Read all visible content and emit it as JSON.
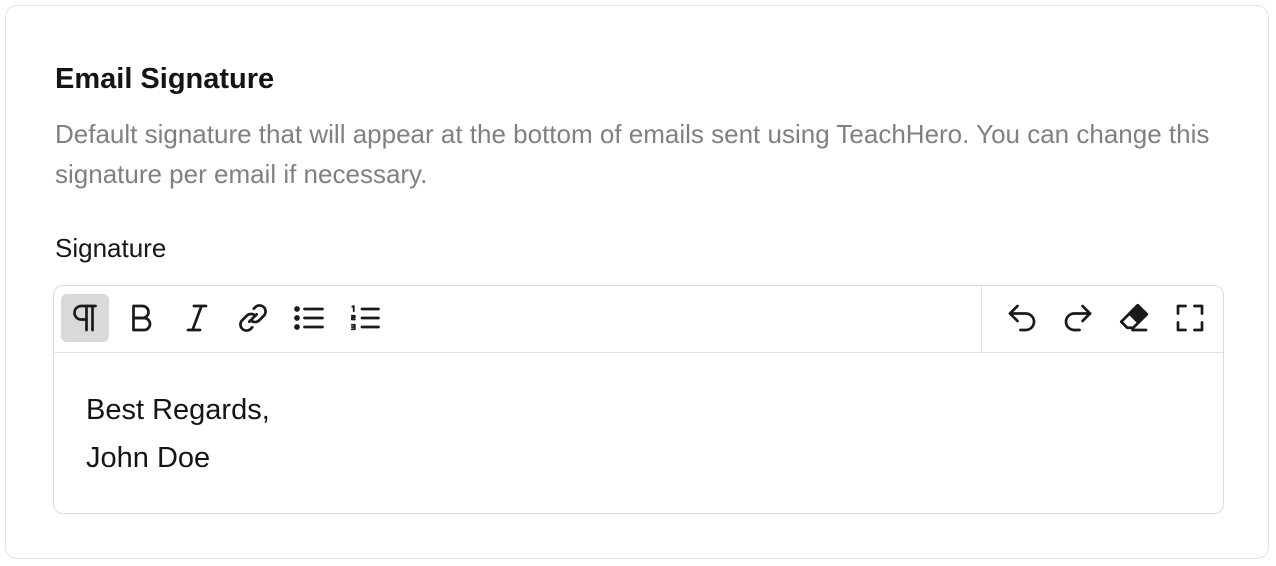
{
  "section": {
    "title": "Email Signature",
    "description": "Default signature that will appear at the bottom of emails sent using TeachHero. You can change this signature per email if necessary."
  },
  "field": {
    "label": "Signature"
  },
  "editor": {
    "toolbar_left": [
      {
        "icon": "paragraph-icon",
        "active": true
      },
      {
        "icon": "bold-icon",
        "active": false
      },
      {
        "icon": "italic-icon",
        "active": false
      },
      {
        "icon": "link-icon",
        "active": false
      },
      {
        "icon": "bullet-list-icon",
        "active": false
      },
      {
        "icon": "numbered-list-icon",
        "active": false
      }
    ],
    "toolbar_right": [
      {
        "icon": "undo-icon"
      },
      {
        "icon": "redo-icon"
      },
      {
        "icon": "clear-formatting-icon"
      },
      {
        "icon": "fullscreen-icon"
      }
    ],
    "lines": [
      "Best Regards,",
      "John Doe"
    ]
  },
  "colors": {
    "text": "#141414",
    "muted": "#808080",
    "border": "#dcdcdc",
    "active_button": "#d9d9d9"
  }
}
